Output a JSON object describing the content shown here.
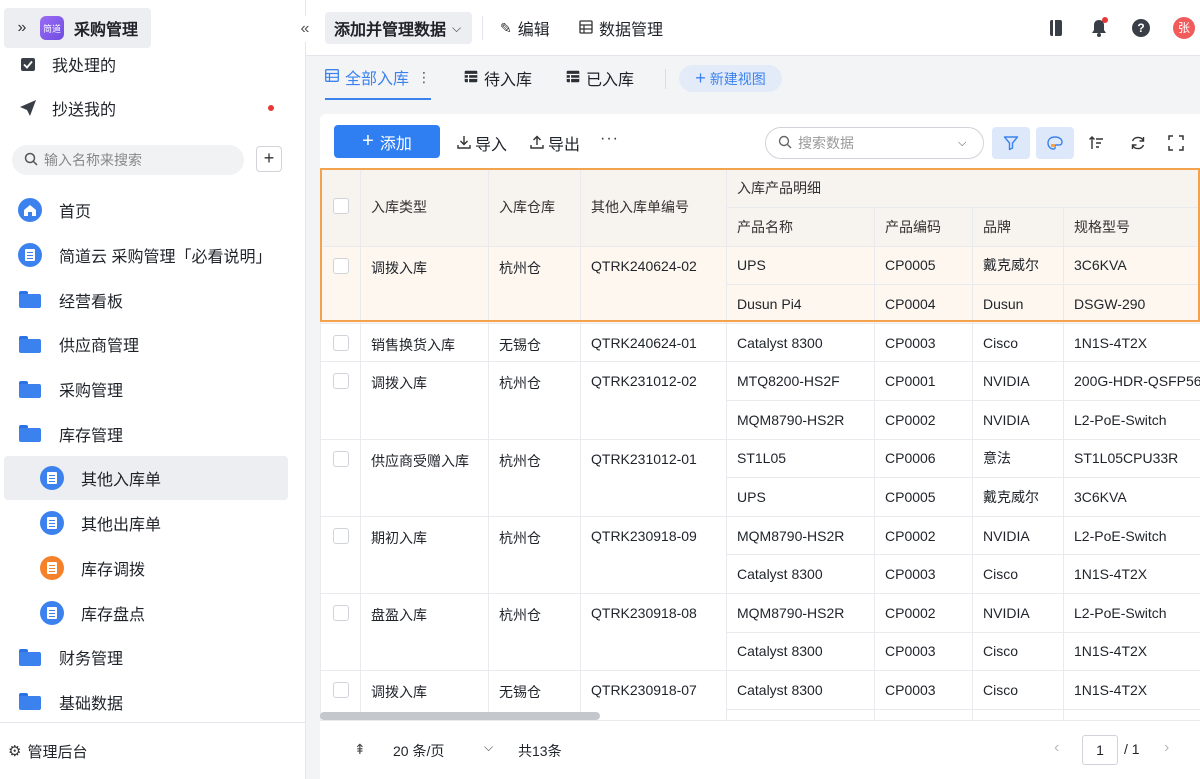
{
  "app": {
    "name": "采购管理",
    "logo_text": "简道"
  },
  "sidebar": {
    "top_items": [
      {
        "label": "我处理的",
        "icon": "check-square-icon"
      },
      {
        "label": "抄送我的",
        "icon": "send-icon",
        "has_badge": true
      }
    ],
    "search": {
      "placeholder": "输入名称来搜索"
    },
    "nav": [
      {
        "label": "首页",
        "icon": "home-icon"
      },
      {
        "label": "简道云 采购管理「必看说明」",
        "icon": "doc-icon"
      },
      {
        "label": "经营看板",
        "icon": "folder-icon"
      },
      {
        "label": "供应商管理",
        "icon": "folder-icon"
      },
      {
        "label": "采购管理",
        "icon": "folder-icon"
      },
      {
        "label": "库存管理",
        "icon": "folder-open-icon"
      },
      {
        "label": "其他入库单",
        "icon": "doc-icon",
        "sub": true,
        "active": true
      },
      {
        "label": "其他出库单",
        "icon": "doc-icon",
        "sub": true
      },
      {
        "label": "库存调拨",
        "icon": "transfer-icon",
        "sub": true
      },
      {
        "label": "库存盘点",
        "icon": "doc-icon",
        "sub": true
      },
      {
        "label": "财务管理",
        "icon": "folder-icon"
      },
      {
        "label": "基础数据",
        "icon": "folder-icon"
      }
    ],
    "admin_label": "管理后台"
  },
  "header": {
    "view_switch_label": "添加并管理数据",
    "edit_label": "编辑",
    "data_manage_label": "数据管理"
  },
  "tabs": [
    {
      "label": "全部入库",
      "active": true
    },
    {
      "label": "待入库"
    },
    {
      "label": "已入库"
    }
  ],
  "new_view_label": "新建视图",
  "toolbar": {
    "add_label": "添加",
    "import_label": "导入",
    "export_label": "导出",
    "more_label": "···",
    "search_placeholder": "搜索数据"
  },
  "table": {
    "headers": {
      "type": "入库类型",
      "warehouse": "入库仓库",
      "number": "其他入库单编号",
      "detail_group": "入库产品明细",
      "product_name": "产品名称",
      "product_code": "产品编码",
      "brand": "品牌",
      "spec": "规格型号"
    },
    "records": [
      {
        "type": "调拨入库",
        "warehouse": "杭州仓",
        "number": "QTRK240624-02",
        "highlight": true,
        "items": [
          {
            "name": "UPS",
            "code": "CP0005",
            "brand": "戴克威尔",
            "spec": "3C6KVA"
          },
          {
            "name": "Dusun Pi4",
            "code": "CP0004",
            "brand": "Dusun",
            "spec": "DSGW-290"
          }
        ]
      },
      {
        "type": "销售换货入库",
        "warehouse": "无锡仓",
        "number": "QTRK240624-01",
        "items": [
          {
            "name": "Catalyst 8300",
            "code": "CP0003",
            "brand": "Cisco",
            "spec": "1N1S-4T2X"
          }
        ]
      },
      {
        "type": "调拨入库",
        "warehouse": "杭州仓",
        "number": "QTRK231012-02",
        "items": [
          {
            "name": "MTQ8200-HS2F",
            "code": "CP0001",
            "brand": "NVIDIA",
            "spec": "200G-HDR-QSFP56"
          },
          {
            "name": "MQM8790-HS2R",
            "code": "CP0002",
            "brand": "NVIDIA",
            "spec": "L2-PoE-Switch"
          }
        ]
      },
      {
        "type": "供应商受赠入库",
        "warehouse": "杭州仓",
        "number": "QTRK231012-01",
        "items": [
          {
            "name": "ST1L05",
            "code": "CP0006",
            "brand": "意法",
            "spec": "ST1L05CPU33R"
          },
          {
            "name": "UPS",
            "code": "CP0005",
            "brand": "戴克威尔",
            "spec": "3C6KVA"
          }
        ]
      },
      {
        "type": "期初入库",
        "warehouse": "杭州仓",
        "number": "QTRK230918-09",
        "items": [
          {
            "name": "MQM8790-HS2R",
            "code": "CP0002",
            "brand": "NVIDIA",
            "spec": "L2-PoE-Switch"
          },
          {
            "name": "Catalyst 8300",
            "code": "CP0003",
            "brand": "Cisco",
            "spec": "1N1S-4T2X"
          }
        ]
      },
      {
        "type": "盘盈入库",
        "warehouse": "杭州仓",
        "number": "QTRK230918-08",
        "items": [
          {
            "name": "MQM8790-HS2R",
            "code": "CP0002",
            "brand": "NVIDIA",
            "spec": "L2-PoE-Switch"
          },
          {
            "name": "Catalyst 8300",
            "code": "CP0003",
            "brand": "Cisco",
            "spec": "1N1S-4T2X"
          }
        ]
      },
      {
        "type": "调拨入库",
        "warehouse": "无锡仓",
        "number": "QTRK230918-07",
        "items": [
          {
            "name": "Catalyst 8300",
            "code": "CP0003",
            "brand": "Cisco",
            "spec": "1N1S-4T2X"
          }
        ]
      }
    ]
  },
  "footer": {
    "page_size": "20 条/页",
    "total": "共13条",
    "current_page": "1",
    "page_total": "/ 1"
  },
  "user": {
    "avatar_text": "张"
  },
  "colors": {
    "accent": "#2f7ef2",
    "highlight_border": "#f3a34d",
    "badge": "#e53935"
  }
}
